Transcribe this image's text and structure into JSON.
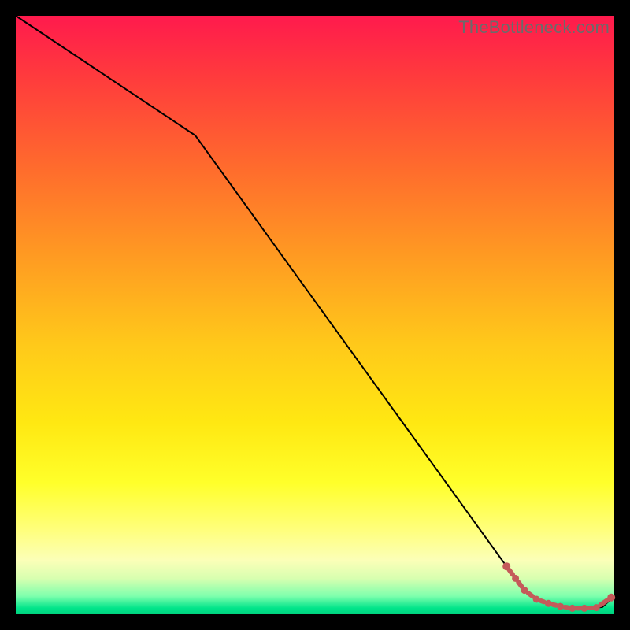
{
  "watermark": "TheBottleneck.com",
  "colors": {
    "background": "#000000",
    "curve": "#000000",
    "marker": "#c45a5a",
    "gradient_top": "#ff1a4d",
    "gradient_bottom": "#00d27e"
  },
  "chart_data": {
    "type": "line",
    "title": "",
    "xlabel": "",
    "ylabel": "",
    "xlim": [
      0,
      100
    ],
    "ylim": [
      0,
      100
    ],
    "grid": false,
    "legend": false,
    "series": [
      {
        "name": "bottleneck-curve",
        "x": [
          0,
          30,
          82,
          85,
          88,
          90,
          92,
          94,
          96,
          98,
          100
        ],
        "y": [
          100,
          80,
          8,
          4,
          2,
          1.5,
          1,
          1,
          1,
          1.2,
          3
        ]
      }
    ],
    "markers": {
      "name": "highlight-points",
      "x": [
        82,
        83.5,
        85,
        87,
        89,
        91,
        93,
        95,
        97,
        99.5
      ],
      "y": [
        8,
        6,
        4,
        2.5,
        1.8,
        1.3,
        1,
        1,
        1.1,
        2.8
      ]
    }
  }
}
